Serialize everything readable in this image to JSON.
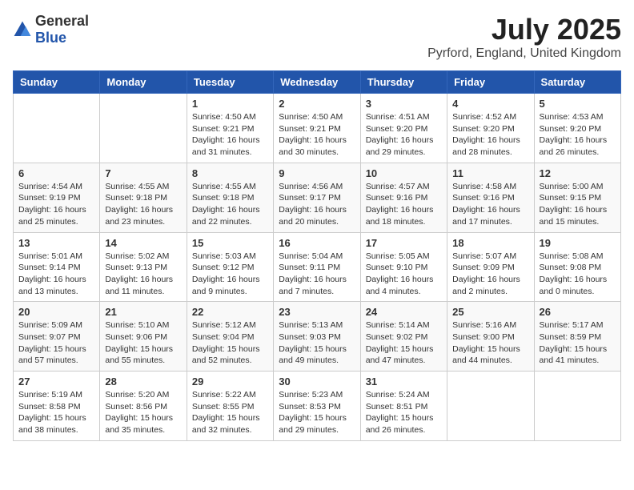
{
  "header": {
    "logo_general": "General",
    "logo_blue": "Blue",
    "month_year": "July 2025",
    "location": "Pyrford, England, United Kingdom"
  },
  "weekdays": [
    "Sunday",
    "Monday",
    "Tuesday",
    "Wednesday",
    "Thursday",
    "Friday",
    "Saturday"
  ],
  "weeks": [
    [
      {
        "day": "",
        "sunrise": "",
        "sunset": "",
        "daylight": ""
      },
      {
        "day": "",
        "sunrise": "",
        "sunset": "",
        "daylight": ""
      },
      {
        "day": "1",
        "sunrise": "Sunrise: 4:50 AM",
        "sunset": "Sunset: 9:21 PM",
        "daylight": "Daylight: 16 hours and 31 minutes."
      },
      {
        "day": "2",
        "sunrise": "Sunrise: 4:50 AM",
        "sunset": "Sunset: 9:21 PM",
        "daylight": "Daylight: 16 hours and 30 minutes."
      },
      {
        "day": "3",
        "sunrise": "Sunrise: 4:51 AM",
        "sunset": "Sunset: 9:20 PM",
        "daylight": "Daylight: 16 hours and 29 minutes."
      },
      {
        "day": "4",
        "sunrise": "Sunrise: 4:52 AM",
        "sunset": "Sunset: 9:20 PM",
        "daylight": "Daylight: 16 hours and 28 minutes."
      },
      {
        "day": "5",
        "sunrise": "Sunrise: 4:53 AM",
        "sunset": "Sunset: 9:20 PM",
        "daylight": "Daylight: 16 hours and 26 minutes."
      }
    ],
    [
      {
        "day": "6",
        "sunrise": "Sunrise: 4:54 AM",
        "sunset": "Sunset: 9:19 PM",
        "daylight": "Daylight: 16 hours and 25 minutes."
      },
      {
        "day": "7",
        "sunrise": "Sunrise: 4:55 AM",
        "sunset": "Sunset: 9:18 PM",
        "daylight": "Daylight: 16 hours and 23 minutes."
      },
      {
        "day": "8",
        "sunrise": "Sunrise: 4:55 AM",
        "sunset": "Sunset: 9:18 PM",
        "daylight": "Daylight: 16 hours and 22 minutes."
      },
      {
        "day": "9",
        "sunrise": "Sunrise: 4:56 AM",
        "sunset": "Sunset: 9:17 PM",
        "daylight": "Daylight: 16 hours and 20 minutes."
      },
      {
        "day": "10",
        "sunrise": "Sunrise: 4:57 AM",
        "sunset": "Sunset: 9:16 PM",
        "daylight": "Daylight: 16 hours and 18 minutes."
      },
      {
        "day": "11",
        "sunrise": "Sunrise: 4:58 AM",
        "sunset": "Sunset: 9:16 PM",
        "daylight": "Daylight: 16 hours and 17 minutes."
      },
      {
        "day": "12",
        "sunrise": "Sunrise: 5:00 AM",
        "sunset": "Sunset: 9:15 PM",
        "daylight": "Daylight: 16 hours and 15 minutes."
      }
    ],
    [
      {
        "day": "13",
        "sunrise": "Sunrise: 5:01 AM",
        "sunset": "Sunset: 9:14 PM",
        "daylight": "Daylight: 16 hours and 13 minutes."
      },
      {
        "day": "14",
        "sunrise": "Sunrise: 5:02 AM",
        "sunset": "Sunset: 9:13 PM",
        "daylight": "Daylight: 16 hours and 11 minutes."
      },
      {
        "day": "15",
        "sunrise": "Sunrise: 5:03 AM",
        "sunset": "Sunset: 9:12 PM",
        "daylight": "Daylight: 16 hours and 9 minutes."
      },
      {
        "day": "16",
        "sunrise": "Sunrise: 5:04 AM",
        "sunset": "Sunset: 9:11 PM",
        "daylight": "Daylight: 16 hours and 7 minutes."
      },
      {
        "day": "17",
        "sunrise": "Sunrise: 5:05 AM",
        "sunset": "Sunset: 9:10 PM",
        "daylight": "Daylight: 16 hours and 4 minutes."
      },
      {
        "day": "18",
        "sunrise": "Sunrise: 5:07 AM",
        "sunset": "Sunset: 9:09 PM",
        "daylight": "Daylight: 16 hours and 2 minutes."
      },
      {
        "day": "19",
        "sunrise": "Sunrise: 5:08 AM",
        "sunset": "Sunset: 9:08 PM",
        "daylight": "Daylight: 16 hours and 0 minutes."
      }
    ],
    [
      {
        "day": "20",
        "sunrise": "Sunrise: 5:09 AM",
        "sunset": "Sunset: 9:07 PM",
        "daylight": "Daylight: 15 hours and 57 minutes."
      },
      {
        "day": "21",
        "sunrise": "Sunrise: 5:10 AM",
        "sunset": "Sunset: 9:06 PM",
        "daylight": "Daylight: 15 hours and 55 minutes."
      },
      {
        "day": "22",
        "sunrise": "Sunrise: 5:12 AM",
        "sunset": "Sunset: 9:04 PM",
        "daylight": "Daylight: 15 hours and 52 minutes."
      },
      {
        "day": "23",
        "sunrise": "Sunrise: 5:13 AM",
        "sunset": "Sunset: 9:03 PM",
        "daylight": "Daylight: 15 hours and 49 minutes."
      },
      {
        "day": "24",
        "sunrise": "Sunrise: 5:14 AM",
        "sunset": "Sunset: 9:02 PM",
        "daylight": "Daylight: 15 hours and 47 minutes."
      },
      {
        "day": "25",
        "sunrise": "Sunrise: 5:16 AM",
        "sunset": "Sunset: 9:00 PM",
        "daylight": "Daylight: 15 hours and 44 minutes."
      },
      {
        "day": "26",
        "sunrise": "Sunrise: 5:17 AM",
        "sunset": "Sunset: 8:59 PM",
        "daylight": "Daylight: 15 hours and 41 minutes."
      }
    ],
    [
      {
        "day": "27",
        "sunrise": "Sunrise: 5:19 AM",
        "sunset": "Sunset: 8:58 PM",
        "daylight": "Daylight: 15 hours and 38 minutes."
      },
      {
        "day": "28",
        "sunrise": "Sunrise: 5:20 AM",
        "sunset": "Sunset: 8:56 PM",
        "daylight": "Daylight: 15 hours and 35 minutes."
      },
      {
        "day": "29",
        "sunrise": "Sunrise: 5:22 AM",
        "sunset": "Sunset: 8:55 PM",
        "daylight": "Daylight: 15 hours and 32 minutes."
      },
      {
        "day": "30",
        "sunrise": "Sunrise: 5:23 AM",
        "sunset": "Sunset: 8:53 PM",
        "daylight": "Daylight: 15 hours and 29 minutes."
      },
      {
        "day": "31",
        "sunrise": "Sunrise: 5:24 AM",
        "sunset": "Sunset: 8:51 PM",
        "daylight": "Daylight: 15 hours and 26 minutes."
      },
      {
        "day": "",
        "sunrise": "",
        "sunset": "",
        "daylight": ""
      },
      {
        "day": "",
        "sunrise": "",
        "sunset": "",
        "daylight": ""
      }
    ]
  ]
}
